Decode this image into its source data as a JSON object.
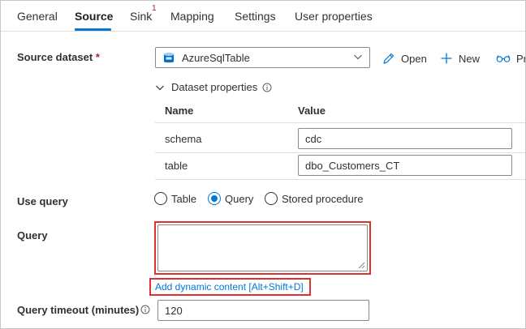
{
  "tabs": [
    {
      "label": "General"
    },
    {
      "label": "Source"
    },
    {
      "label": "Sink"
    },
    {
      "label": "Mapping"
    },
    {
      "label": "Settings"
    },
    {
      "label": "User properties"
    }
  ],
  "sink_badge": "1",
  "active_tab": "Source",
  "source_dataset": {
    "label": "Source dataset",
    "required_mark": "*",
    "value": "AzureSqlTable",
    "actions": {
      "open": "Open",
      "new": "New",
      "preview": "Pr"
    }
  },
  "dataset_properties": {
    "title": "Dataset properties",
    "columns": {
      "name": "Name",
      "value": "Value"
    },
    "rows": [
      {
        "name": "schema",
        "value": "cdc"
      },
      {
        "name": "table",
        "value": "dbo_Customers_CT"
      }
    ]
  },
  "use_query": {
    "label": "Use query",
    "options": [
      "Table",
      "Query",
      "Stored procedure"
    ],
    "selected": "Query"
  },
  "query": {
    "label": "Query",
    "value": ""
  },
  "dynamic_content_link": "Add dynamic content [Alt+Shift+D]",
  "query_timeout": {
    "label": "Query timeout (minutes)",
    "value": "120"
  },
  "colors": {
    "accent": "#0078d4",
    "highlight": "#e03131",
    "required": "#a4262c"
  },
  "icons": [
    "sql-database-icon",
    "chevron-down-icon",
    "pencil-icon",
    "plus-icon",
    "glasses-icon",
    "info-icon",
    "resize-grip-icon"
  ]
}
